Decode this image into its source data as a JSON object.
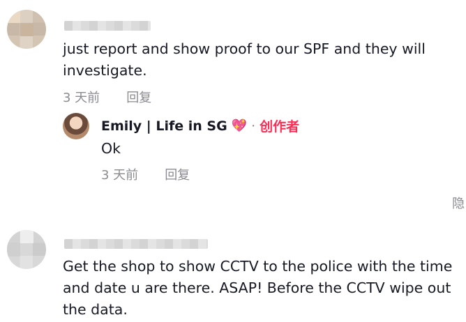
{
  "comments": [
    {
      "text": "just report and show proof to our SPF and they will investigate.",
      "time": "3 天前",
      "reply_label": "回复"
    },
    {
      "text": "Get the shop to show CCTV to the police with the time and date u are there. ASAP! Before the CCTV wipe out the data."
    }
  ],
  "reply": {
    "author": "Emily | Life in SG",
    "emoji": "💖",
    "separator": "·",
    "badge": "创作者",
    "text": "Ok",
    "time": "3 天前",
    "reply_label": "回复"
  },
  "hide_label": "隐",
  "colors": {
    "creator_badge": "#fe2c55",
    "meta_gray": "#8a8b91",
    "text": "#161823"
  }
}
